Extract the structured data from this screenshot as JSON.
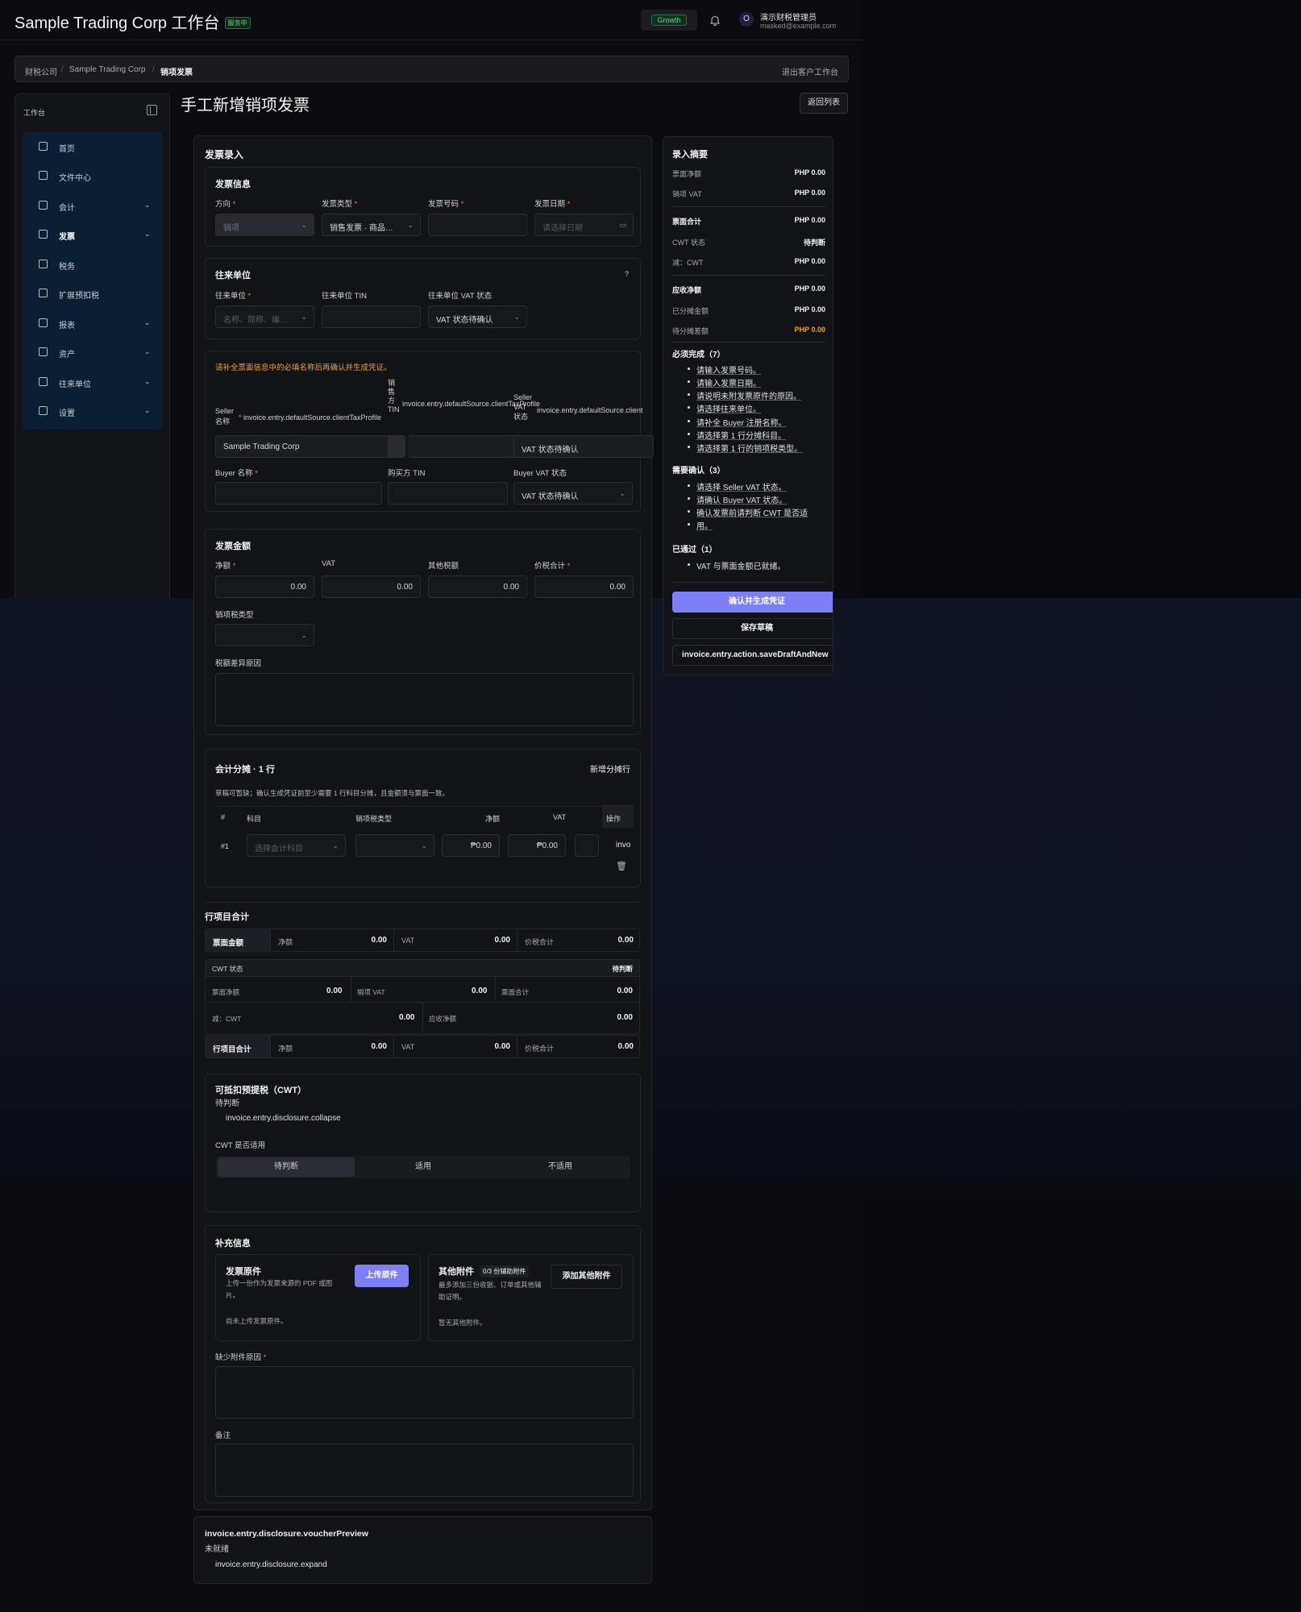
{
  "header": {
    "app_title": "Sample Trading Corp 工作台",
    "status_badge": "服务中",
    "plan": "Growth",
    "avatar_initial": "O",
    "user_name": "演示财税管理员",
    "user_email": "masked@example.com"
  },
  "breadcrumb": {
    "items": [
      "财税公司",
      "Sample Trading Corp",
      "销项发票"
    ],
    "exit": "退出客户工作台"
  },
  "sidebar": {
    "title": "工作台",
    "items": [
      {
        "label": "首页",
        "icon": "home-icon"
      },
      {
        "label": "文件中心",
        "icon": "folder-icon"
      },
      {
        "label": "会计",
        "icon": "book-icon"
      },
      {
        "label": "发票",
        "icon": "invoice-icon"
      },
      {
        "label": "税务",
        "icon": "tax-icon"
      },
      {
        "label": "扩展预扣税",
        "icon": "withholding-icon"
      },
      {
        "label": "报表",
        "icon": "chart-icon"
      },
      {
        "label": "资产",
        "icon": "assets-icon"
      },
      {
        "label": "往来单位",
        "icon": "contacts-icon"
      },
      {
        "label": "设置",
        "icon": "gear-icon"
      }
    ]
  },
  "page": {
    "title": "手工新增销项发票",
    "back": "返回列表"
  },
  "form": {
    "title": "发票录入",
    "invoice_info": {
      "title": "发票信息",
      "direction_label": "方向",
      "direction_value": "销项",
      "type_label": "发票类型",
      "type_value": "销售发票 · 商品…",
      "number_label": "发票号码",
      "date_label": "发票日期",
      "date_placeholder": "请选择日期"
    },
    "counterparty": {
      "title": "往来单位",
      "help": "?",
      "unit_label": "往来单位",
      "unit_placeholder": "名称、简称、编…",
      "tin_label": "往来单位 TIN",
      "vat_label": "往来单位 VAT 状态",
      "vat_value": "VAT 状态待确认"
    },
    "parties": {
      "warning": "请补全票面信息中的必填名称后再确认并生成凭证。",
      "seller_name_label": "Seller\n名称",
      "seller_name_source": "invoice.entry.defaultSource.clientTaxProfile",
      "seller_tin_label": "销\n售\n方\nTIN",
      "seller_tin_source": "invoice.entry.defaultSource.clientTaxProfile",
      "seller_vat_label": "Seller\nVAT\n状态",
      "seller_vat_source": "invoice.entry.defaultSource.client",
      "seller_name_value": "Sample Trading Corp",
      "seller_vat_value": "VAT 状态待确认",
      "buyer_name_label": "Buyer 名称",
      "buyer_tin_label": "购买方 TIN",
      "buyer_vat_label": "Buyer VAT 状态",
      "buyer_vat_value": "VAT 状态待确认"
    },
    "amounts": {
      "title": "发票金额",
      "net_label": "净额",
      "net": "0.00",
      "vat_label": "VAT",
      "vat": "0.00",
      "other_label": "其他税额",
      "other": "0.00",
      "total_label": "价税合计",
      "total": "0.00",
      "tax_type_label": "销项税类型",
      "diff_reason_label": "税额差异原因"
    },
    "allocation": {
      "title": "会计分摊 · 1 行",
      "add_row": "新增分摊行",
      "hint": "草稿可暂缺；确认生成凭证前至少需要 1 行科目分摊，且金额须与票面一致。",
      "columns": [
        "#",
        "科目",
        "销项税类型",
        "净额",
        "VAT",
        "操作"
      ],
      "row": {
        "index": "#1",
        "account_placeholder": "选择会计科目",
        "net": "₱0.00",
        "vat": "₱0.00",
        "action_text": "invo"
      }
    },
    "line_totals": {
      "title": "行项目合计",
      "face_head": "票面金额",
      "net_label": "净额",
      "net": "0.00",
      "vat_label": "VAT",
      "vat": "0.00",
      "total_label": "价税合计",
      "total": "0.00",
      "cwt_status_label": "CWT 状态",
      "cwt_status": "待判断",
      "face_net_label": "票面净额",
      "face_net": "0.00",
      "output_vat_label": "销项 VAT",
      "output_vat": "0.00",
      "face_total_label": "票面合计",
      "face_total": "0.00",
      "less_cwt_label": "减：CWT",
      "less_cwt": "0.00",
      "receivable_label": "应收净额",
      "receivable": "0.00",
      "line_head": "行项目合计",
      "line_net": "0.00",
      "line_vat": "0.00",
      "line_total": "0.00"
    },
    "cwt": {
      "title": "可抵扣预提税（CWT）",
      "status": "待判断",
      "collapse": "invoice.entry.disclosure.collapse",
      "applicable_label": "CWT 是否适用",
      "options": [
        "待判断",
        "适用",
        "不适用"
      ]
    },
    "supplement": {
      "title": "补充信息",
      "original_title": "发票原件",
      "original_desc": "上传一份作为发票来源的 PDF 或图片。",
      "original_empty": "尚未上传发票原件。",
      "upload": "上传原件",
      "other_title": "其他附件",
      "other_badge": "0/3 份辅助附件",
      "other_desc": "最多添加三份收据、订单或其他辅助证明。",
      "other_empty": "暂无其他附件。",
      "add_other": "添加其他附件",
      "missing_reason_label": "缺少附件原因",
      "remark_label": "备注"
    }
  },
  "voucher": {
    "title": "invoice.entry.disclosure.voucherPreview",
    "status": "未就绪",
    "expand": "invoice.entry.disclosure.expand"
  },
  "summary": {
    "title": "录入摘要",
    "rows": [
      {
        "k": "票面净额",
        "v": "PHP 0.00"
      },
      {
        "k": "销项 VAT",
        "v": "PHP 0.00"
      },
      {
        "k": "票面合计",
        "v": "PHP 0.00"
      },
      {
        "k": "CWT 状态",
        "v": "待判断"
      },
      {
        "k": "减：CWT",
        "v": "PHP 0.00"
      },
      {
        "k": "应收净额",
        "v": "PHP 0.00"
      },
      {
        "k": "已分摊金额",
        "v": "PHP 0.00"
      },
      {
        "k": "待分摊差额",
        "v": "PHP 0.00"
      }
    ],
    "required_title": "必须完成（7）",
    "required": [
      "请输入发票号码。",
      "请输入发票日期。",
      "请说明未附发票原件的原因。",
      "请选择往来单位。",
      "请补全 Buyer 注册名称。",
      "请选择第 1 行分摊科目。",
      "请选择第 1 行的销项税类型。"
    ],
    "confirm_title": "需要确认（3）",
    "confirm": [
      "请选择 Seller VAT 状态。",
      "请确认 Buyer VAT 状态。",
      "确认发票前请判断 CWT 是否适",
      "用。"
    ],
    "passed_title": "已通过（1）",
    "passed": [
      "VAT 与票面金额已就绪。"
    ],
    "btn_confirm": "确认并生成凭证",
    "btn_draft": "保存草稿",
    "btn_draft_new": "invoice.entry.action.saveDraftAndNew",
    "warn_color": "#f0a030"
  }
}
